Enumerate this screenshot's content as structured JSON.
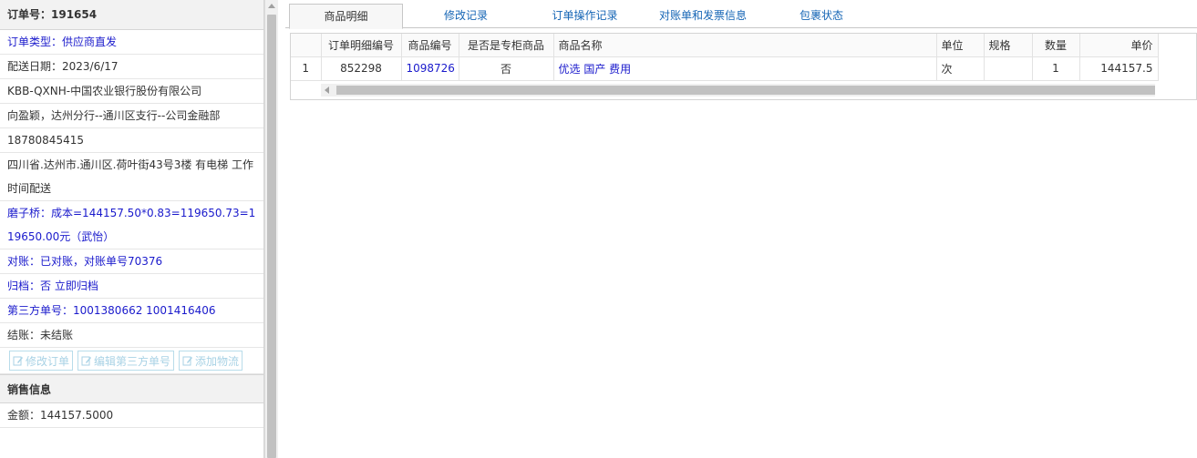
{
  "left_panel": {
    "order_title": "订单号：191654",
    "order_type": "订单类型：供应商直发",
    "delivery_date": "配送日期：2023/6/17",
    "company": "KBB-QXNH-中国农业银行股份有限公司",
    "contact": "向盈颖，达州分行--通川区支行--公司金融部",
    "phone": "18780845415",
    "address": "四川省.达州市.通川区.荷叶街43号3楼 有电梯 工作时间配送",
    "cost_note": "磨子桥：成本=144157.50*0.83=119650.73=119650.00元（武怡）",
    "reconcile": "对账：已对账，对账单号70376",
    "archive": "归档：否 立即归档",
    "third_party": "第三方单号：1001380662 1001416406",
    "settlement": "结账：未结账",
    "buttons": {
      "edit_order": "修改订单",
      "edit_third_party": "编辑第三方单号",
      "add_logistics": "添加物流"
    },
    "sales_header": "销售信息",
    "amount": "金额：144157.5000"
  },
  "tabs": [
    "商品明细",
    "修改记录",
    "订单操作记录",
    "对账单和发票信息",
    "包裹状态"
  ],
  "grid": {
    "headers": [
      "",
      "订单明细编号",
      "商品编号",
      "是否是专柜商品",
      "商品名称",
      "单位",
      "规格",
      "数量",
      "单价"
    ],
    "rows": [
      {
        "row_num": "1",
        "detail_id": "852298",
        "product_id": "1098726",
        "is_counter": "否",
        "product_name": "优选 国产 费用",
        "unit": "次",
        "spec": "",
        "qty": "1",
        "price": "144157.5"
      }
    ]
  },
  "colors": {
    "link": "#1a1acc",
    "tab_link": "#1565b5",
    "button_text": "#a8d2e5"
  }
}
